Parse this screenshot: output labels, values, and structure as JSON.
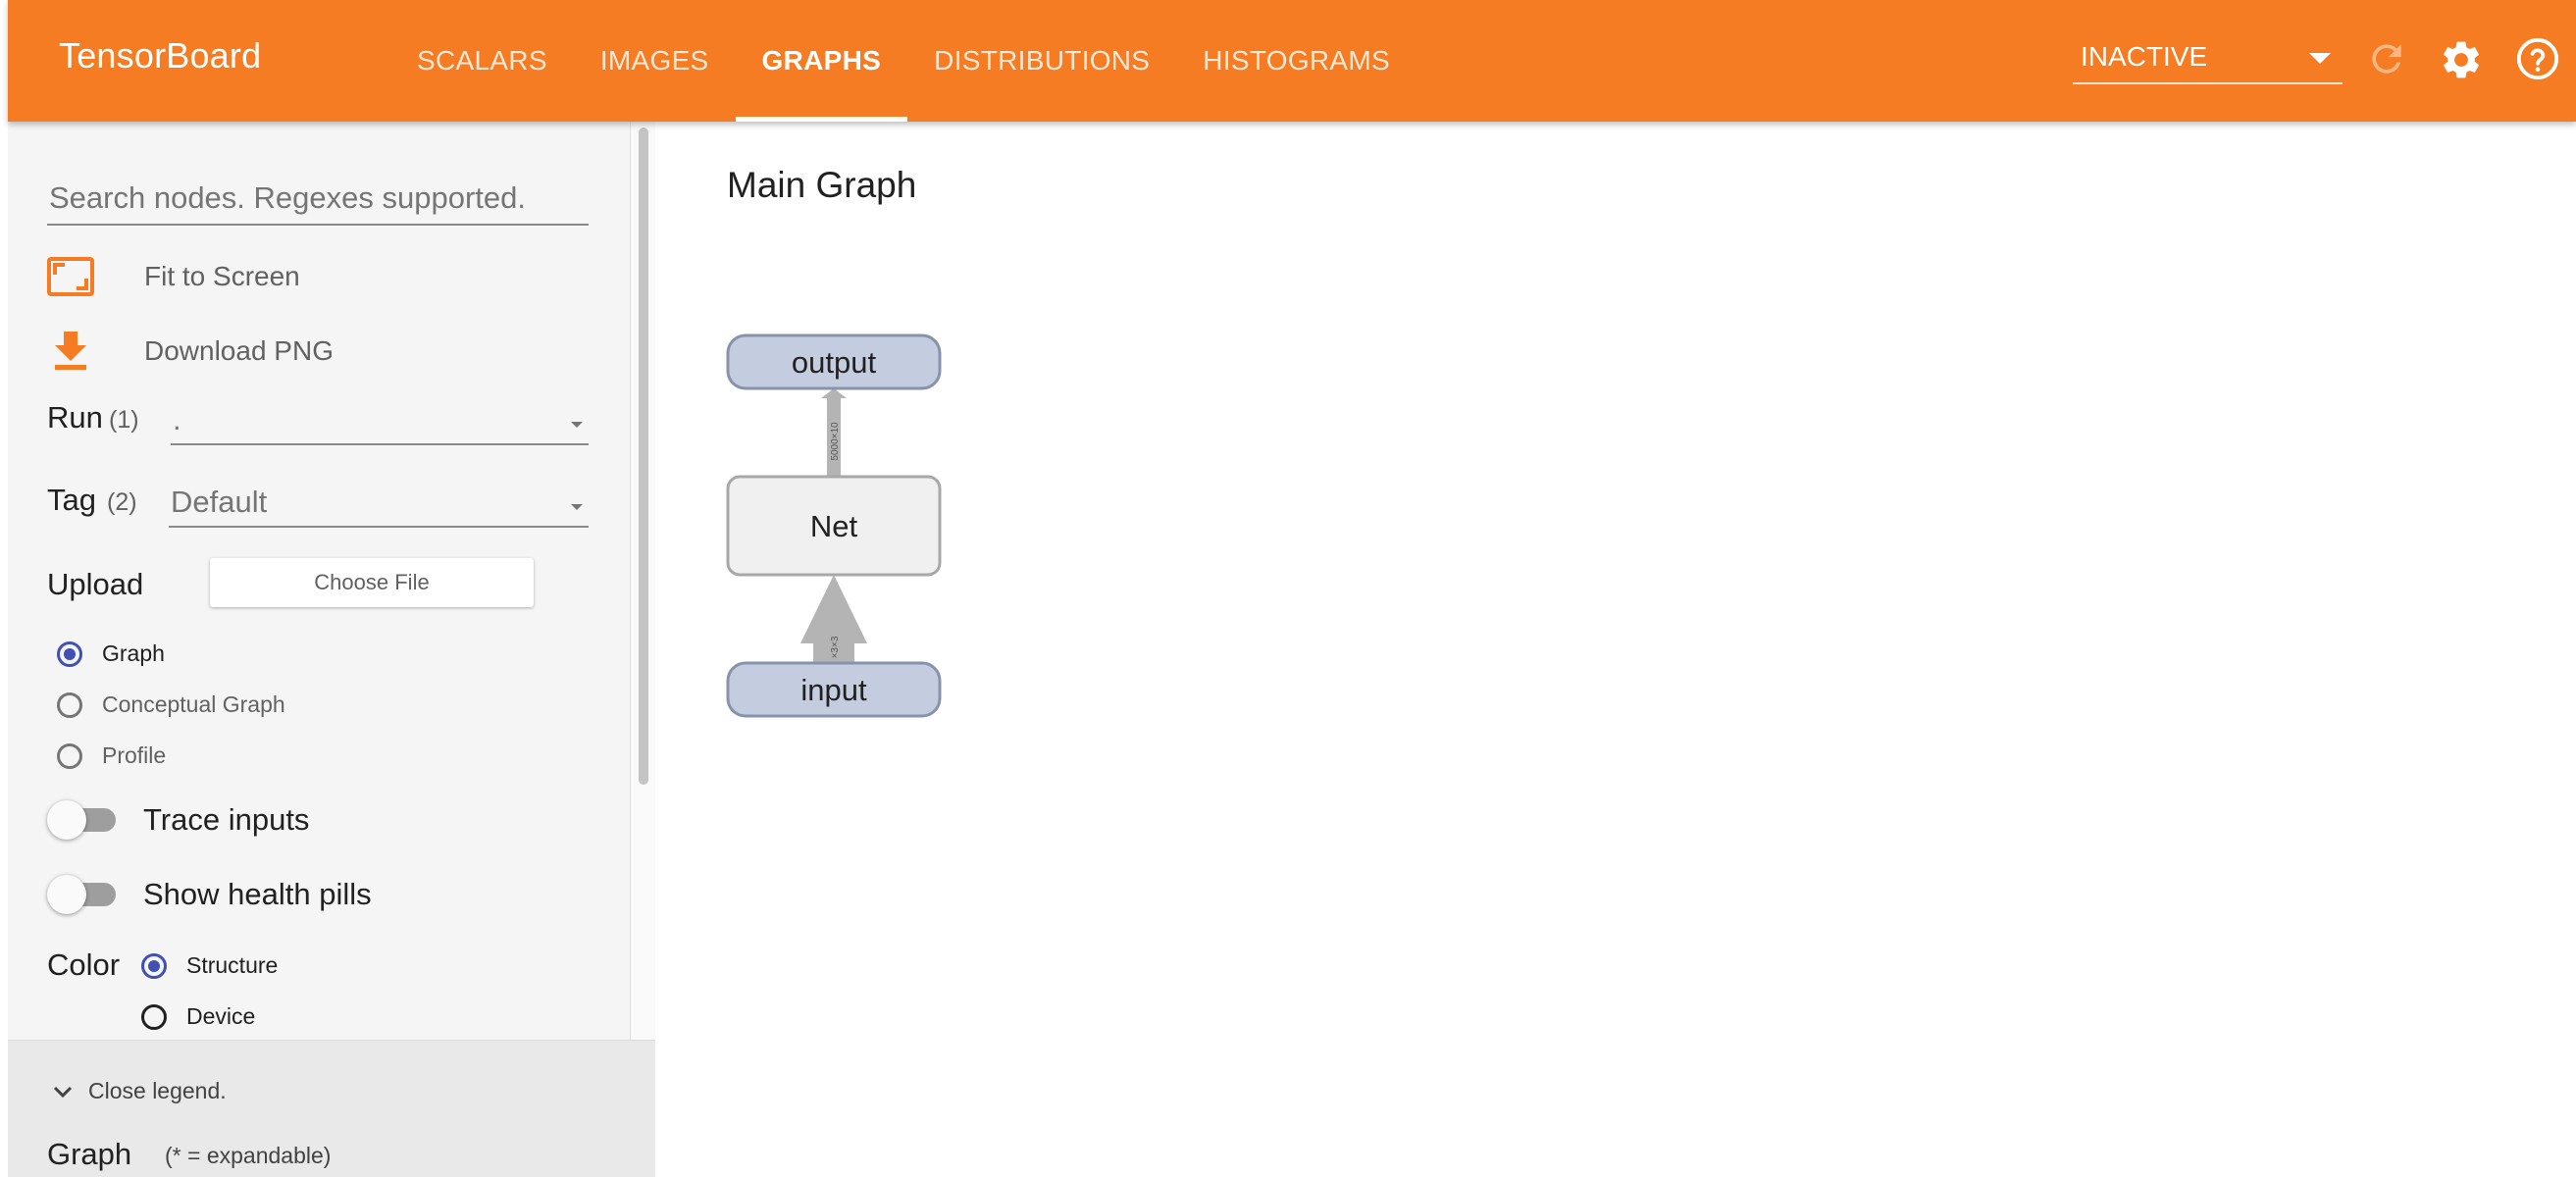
{
  "app": {
    "title": "TensorBoard"
  },
  "tabs": [
    {
      "label": "SCALARS",
      "active": false
    },
    {
      "label": "IMAGES",
      "active": false
    },
    {
      "label": "GRAPHS",
      "active": true
    },
    {
      "label": "DISTRIBUTIONS",
      "active": false
    },
    {
      "label": "HISTOGRAMS",
      "active": false
    }
  ],
  "header": {
    "status_value": "INACTIVE",
    "icons": [
      "refresh-icon",
      "gear-icon",
      "help-icon"
    ]
  },
  "sidebar": {
    "search_placeholder": "Search nodes. Regexes supported.",
    "fit_label": "Fit to Screen",
    "download_label": "Download PNG",
    "run": {
      "label": "Run",
      "count": "(1)",
      "value": "."
    },
    "tag": {
      "label": "Tag",
      "count": "(2)",
      "value": "Default"
    },
    "upload": {
      "label": "Upload",
      "button": "Choose File"
    },
    "graph_types": [
      {
        "label": "Graph",
        "checked": true
      },
      {
        "label": "Conceptual Graph",
        "checked": false
      },
      {
        "label": "Profile",
        "checked": false
      }
    ],
    "trace_inputs": {
      "label": "Trace inputs",
      "on": false
    },
    "health_pills": {
      "label": "Show health pills",
      "on": false
    },
    "color": {
      "label": "Color",
      "options": [
        {
          "label": "Structure",
          "checked": true
        },
        {
          "label": "Device",
          "checked": false
        }
      ]
    },
    "legend": {
      "toggle_label": "Close legend.",
      "title": "Graph",
      "note": "(* = expandable)"
    }
  },
  "main": {
    "title": "Main Graph",
    "graph": {
      "nodes": [
        {
          "label": "output",
          "kind": "io"
        },
        {
          "label": "Net",
          "kind": "group"
        },
        {
          "label": "input",
          "kind": "io"
        }
      ],
      "edges": [
        {
          "from": "input",
          "to": "Net",
          "shape": "×3×3"
        },
        {
          "from": "Net",
          "to": "output",
          "shape": "5000×10"
        }
      ]
    }
  },
  "colors": {
    "brand": "#f57c22",
    "radio_accent": "#3f51b5",
    "io_node_fill": "#c4cde0",
    "group_node_fill": "#f0f0f0"
  }
}
